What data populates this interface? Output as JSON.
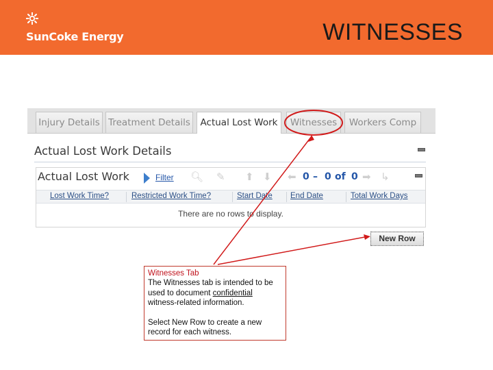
{
  "header": {
    "brand": "SunCoke Energy",
    "title": "WITNESSES",
    "background": "#f26a2e"
  },
  "tabs": [
    {
      "label": "Injury Details",
      "active": false
    },
    {
      "label": "Treatment Details",
      "active": false
    },
    {
      "label": "Actual Lost Work",
      "active": true
    },
    {
      "label": "Witnesses",
      "active": false
    },
    {
      "label": "Workers Comp",
      "active": false
    }
  ],
  "section": {
    "title": "Actual Lost Work Details"
  },
  "grid": {
    "title": "Actual Lost Work",
    "filter_label": "Filter",
    "pager": {
      "from": "0",
      "dash": "–",
      "to": "0",
      "of_label": "of",
      "total": "0"
    },
    "columns": [
      "Lost Work Time?",
      "Restricted Work Time?",
      "Start Date",
      "End Date",
      "Total Work Days"
    ],
    "empty_message": "There are no rows to display.",
    "new_row_label": "New Row"
  },
  "callout": {
    "heading": "Witnesses Tab",
    "line1_pre": "The Witnesses tab is intended to be used to document ",
    "line1_emph": "confidential",
    "line1_post": " witness-related information.",
    "line2": "Select New Row to create a new record for each witness."
  },
  "colors": {
    "annotation": "#d11a1a",
    "link": "#2456a8"
  }
}
